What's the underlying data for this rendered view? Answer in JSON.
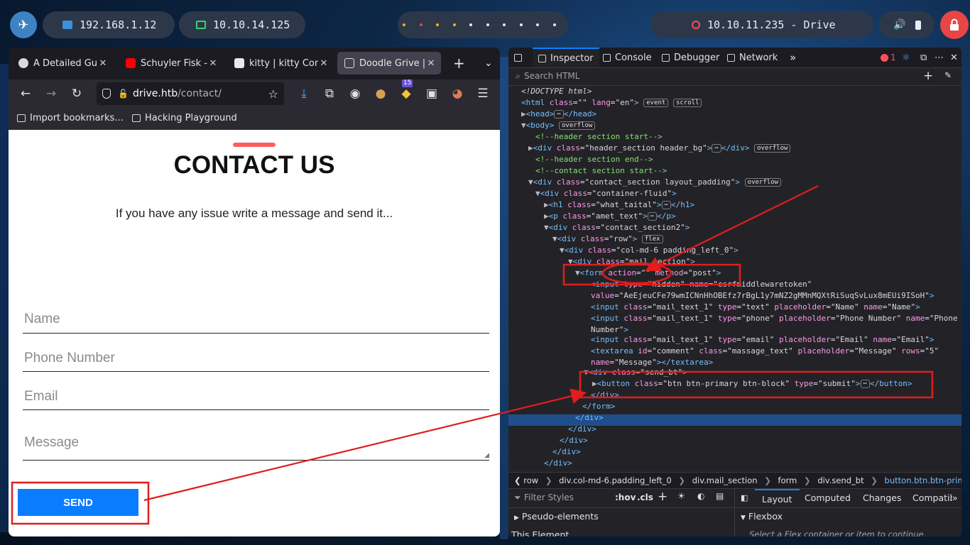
{
  "taskbar": {
    "pill1": "192.168.1.12",
    "pill2": "10.10.14.125",
    "pill3": "10.10.11.235 - Drive",
    "dot_colors": [
      "#ffb400",
      "#e84545",
      "#ffb400",
      "#ffb400",
      "#e8e8e8",
      "#e8e8e8",
      "#e8e8e8",
      "#e8e8e8",
      "#e8e8e8",
      "#e8e8e8"
    ]
  },
  "browser": {
    "tabs": [
      {
        "title": "A Detailed Guid",
        "icon": "wordpress-icon"
      },
      {
        "title": "Schuyler Fisk - ",
        "icon": "youtube-icon"
      },
      {
        "title": "kitty | kitty Con",
        "icon": "kitty-icon"
      },
      {
        "title": "Doodle Grive | C",
        "icon": "page-icon",
        "active": true
      }
    ],
    "url_host": "drive.htb",
    "url_path": "/contact/",
    "extension_badge": "15",
    "bookmarks": [
      "Import bookmarks...",
      "Hacking Playground"
    ]
  },
  "page": {
    "title": "CONTACT US",
    "subtitle": "If you have any issue write a message and send it...",
    "fields": [
      "Name",
      "Phone Number",
      "Email",
      "Message"
    ],
    "send_label": "SEND"
  },
  "devtools": {
    "tabs": [
      "Inspector",
      "Console",
      "Debugger",
      "Network"
    ],
    "error_count": "1",
    "search_placeholder": "Search HTML",
    "breadcrumb": [
      "row",
      "div.col-md-6.padding_left_0",
      "div.mail_section",
      "form",
      "div.send_bt",
      "button.btn.btn-primary.btn-block"
    ],
    "styles_placeholder": "Filter Styles",
    "styles_buttons": [
      ":hov",
      ".cls"
    ],
    "layout_tabs": [
      "Layout",
      "Computed",
      "Changes",
      "Compatib"
    ],
    "pseudo_elements": "Pseudo-elements",
    "this_element": "This Element",
    "flexbox": "Flexbox",
    "flex_hint": "Select a Flex container or item to continue."
  }
}
